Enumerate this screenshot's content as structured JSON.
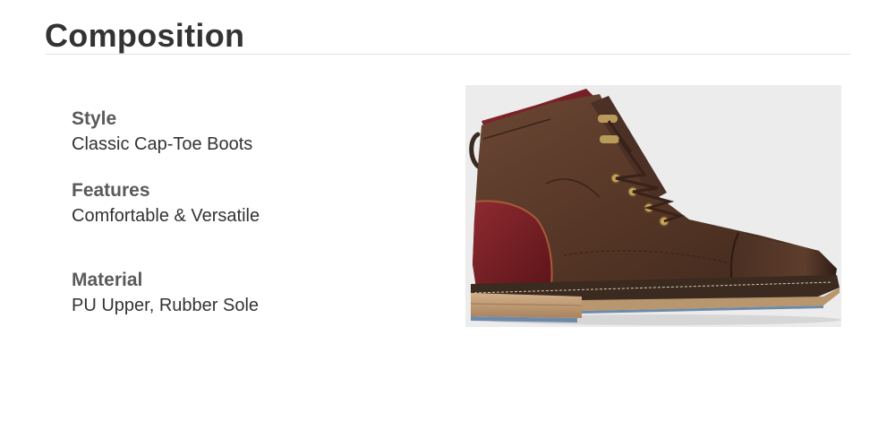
{
  "section": {
    "title": "Composition"
  },
  "specs": [
    {
      "label": "Style",
      "value": "Classic Cap-Toe Boots"
    },
    {
      "label": "Features",
      "value": "Comfortable & Versatile"
    },
    {
      "label": "Material",
      "value": "PU Upper, Rubber Sole"
    }
  ],
  "product_image": {
    "subject": "boot-photo",
    "colors": {
      "background": "#ececec",
      "leather": "#5a3a2a",
      "accent": "#7a1e24",
      "sole": "#c9a27a",
      "outsole": "#6f8aa8"
    }
  }
}
